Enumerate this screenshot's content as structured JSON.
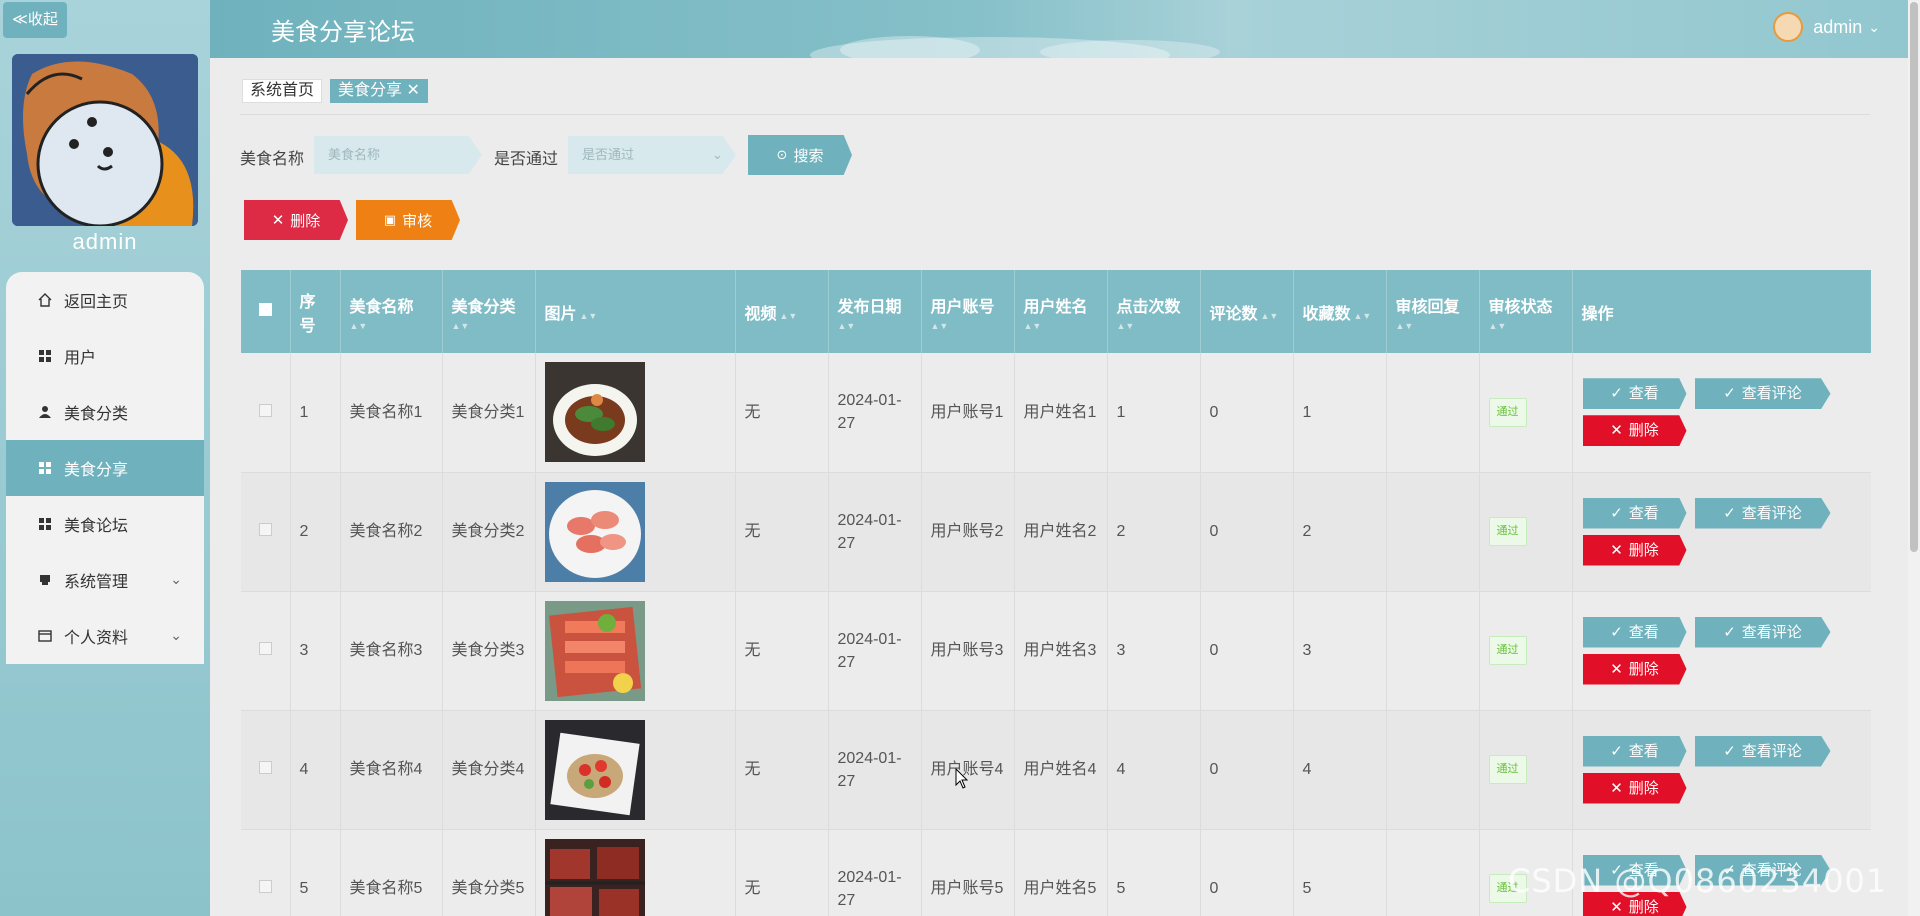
{
  "sidebar": {
    "collapse_label": "≪收起",
    "username": "admin",
    "menu": [
      {
        "label": "返回主页",
        "icon": "home-icon",
        "active": false
      },
      {
        "label": "用户",
        "icon": "grid-icon",
        "active": false
      },
      {
        "label": "美食分类",
        "icon": "person-icon",
        "active": false
      },
      {
        "label": "美食分享",
        "icon": "grid-icon",
        "active": true
      },
      {
        "label": "美食论坛",
        "icon": "grid-icon",
        "active": false
      },
      {
        "label": "系统管理",
        "icon": "printer-icon",
        "active": false,
        "expandable": true
      },
      {
        "label": "个人资料",
        "icon": "card-icon",
        "active": false,
        "expandable": true
      }
    ]
  },
  "header": {
    "title": "美食分享论坛",
    "user": "admin",
    "user_caret": "⌄"
  },
  "tabs": [
    {
      "label": "系统首页",
      "active": false
    },
    {
      "label": "美食分享 ✕",
      "active": true
    }
  ],
  "search": {
    "name_label": "美食名称",
    "name_placeholder": "美食名称",
    "pass_label": "是否通过",
    "pass_placeholder": "是否通过",
    "search_button": "搜索"
  },
  "actions": {
    "delete_label": "删除",
    "audit_label": "审核"
  },
  "table": {
    "headers": [
      "序号",
      "美食名称",
      "美食分类",
      "图片",
      "视频",
      "发布日期",
      "用户账号",
      "用户姓名",
      "点击次数",
      "评论数",
      "收藏数",
      "审核回复",
      "审核状态",
      "操作"
    ],
    "rows": [
      {
        "no": "1",
        "name": "美食名称1",
        "category": "美食分类1",
        "video": "无",
        "date": "2024-01-27",
        "account": "用户账号1",
        "uname": "用户姓名1",
        "clicks": "1",
        "comments": "0",
        "favs": "1",
        "reply": "",
        "status": "通过"
      },
      {
        "no": "2",
        "name": "美食名称2",
        "category": "美食分类2",
        "video": "无",
        "date": "2024-01-27",
        "account": "用户账号2",
        "uname": "用户姓名2",
        "clicks": "2",
        "comments": "0",
        "favs": "2",
        "reply": "",
        "status": "通过"
      },
      {
        "no": "3",
        "name": "美食名称3",
        "category": "美食分类3",
        "video": "无",
        "date": "2024-01-27",
        "account": "用户账号3",
        "uname": "用户姓名3",
        "clicks": "3",
        "comments": "0",
        "favs": "3",
        "reply": "",
        "status": "通过"
      },
      {
        "no": "4",
        "name": "美食名称4",
        "category": "美食分类4",
        "video": "无",
        "date": "2024-01-27",
        "account": "用户账号4",
        "uname": "用户姓名4",
        "clicks": "4",
        "comments": "0",
        "favs": "4",
        "reply": "",
        "status": "通过"
      },
      {
        "no": "5",
        "name": "美食名称5",
        "category": "美食分类5",
        "video": "无",
        "date": "2024-01-27",
        "account": "用户账号5",
        "uname": "用户姓名5",
        "clicks": "5",
        "comments": "0",
        "favs": "5",
        "reply": "",
        "status": "通过"
      }
    ],
    "op_view": "查看",
    "op_comment": "查看评论",
    "op_delete": "删除"
  },
  "watermark": "CSDN @Q0860234001",
  "colors": {
    "accent": "#6fb2bd",
    "danger": "#dd2a45",
    "warning": "#ee8014",
    "success": "#67c23a"
  }
}
